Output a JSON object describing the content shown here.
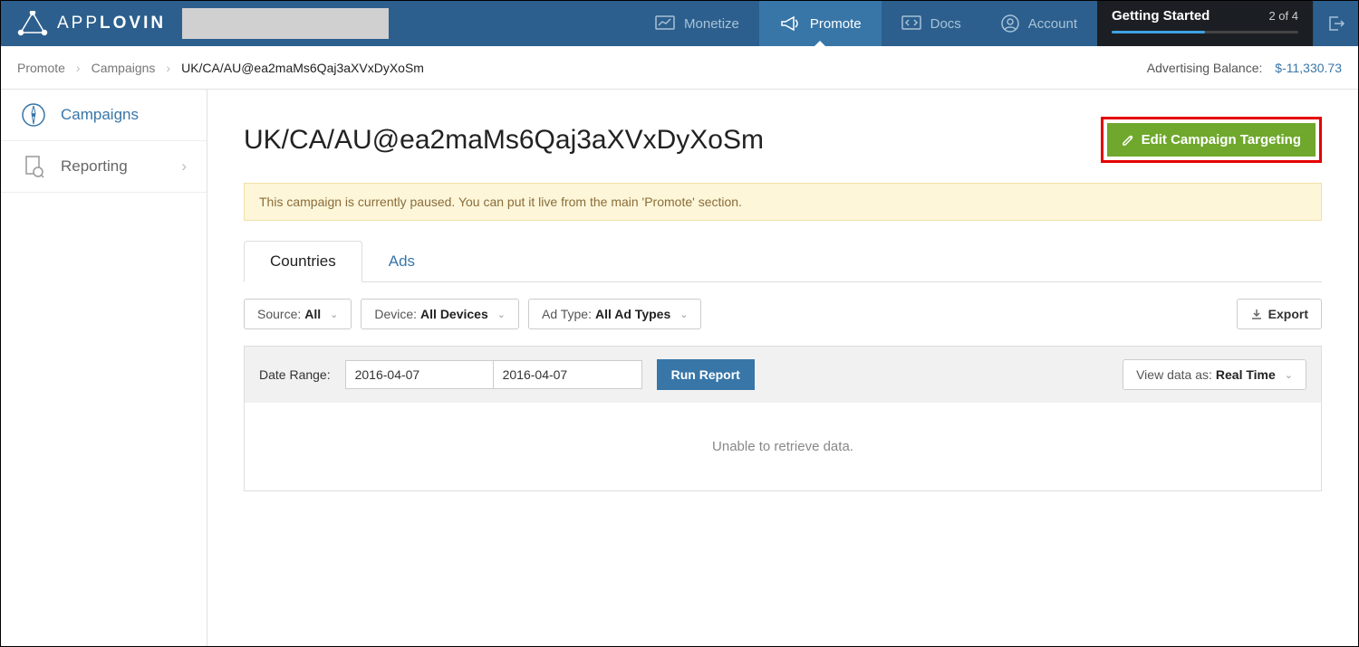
{
  "brand": {
    "name_light": "APP",
    "name_bold": "LOVIN"
  },
  "topnav": {
    "monetize": "Monetize",
    "promote": "Promote",
    "docs": "Docs",
    "account": "Account"
  },
  "getting_started": {
    "label": "Getting Started",
    "count": "2 of 4"
  },
  "breadcrumb": {
    "root": "Promote",
    "mid": "Campaigns",
    "current": "UK/CA/AU@ea2maMs6Qaj3aXVxDyXoSm"
  },
  "balance": {
    "label": "Advertising Balance:",
    "amount": "$-11,330.73"
  },
  "sidebar": {
    "campaigns": "Campaigns",
    "reporting": "Reporting"
  },
  "page": {
    "title": "UK/CA/AU@ea2maMs6Qaj3aXVxDyXoSm",
    "edit_button": "Edit Campaign Targeting",
    "alert": "This campaign is currently paused. You can put it live from the main 'Promote' section."
  },
  "tabs": {
    "countries": "Countries",
    "ads": "Ads"
  },
  "filters": {
    "source_label": "Source:",
    "source_value": "All",
    "device_label": "Device:",
    "device_value": "All Devices",
    "adtype_label": "Ad Type:",
    "adtype_value": "All Ad Types",
    "export": "Export"
  },
  "report": {
    "date_range_label": "Date Range:",
    "date_from": "2016-04-07",
    "date_to": "2016-04-07",
    "run": "Run Report",
    "viewas_label": "View data as:",
    "viewas_value": "Real Time",
    "empty": "Unable to retrieve data."
  }
}
